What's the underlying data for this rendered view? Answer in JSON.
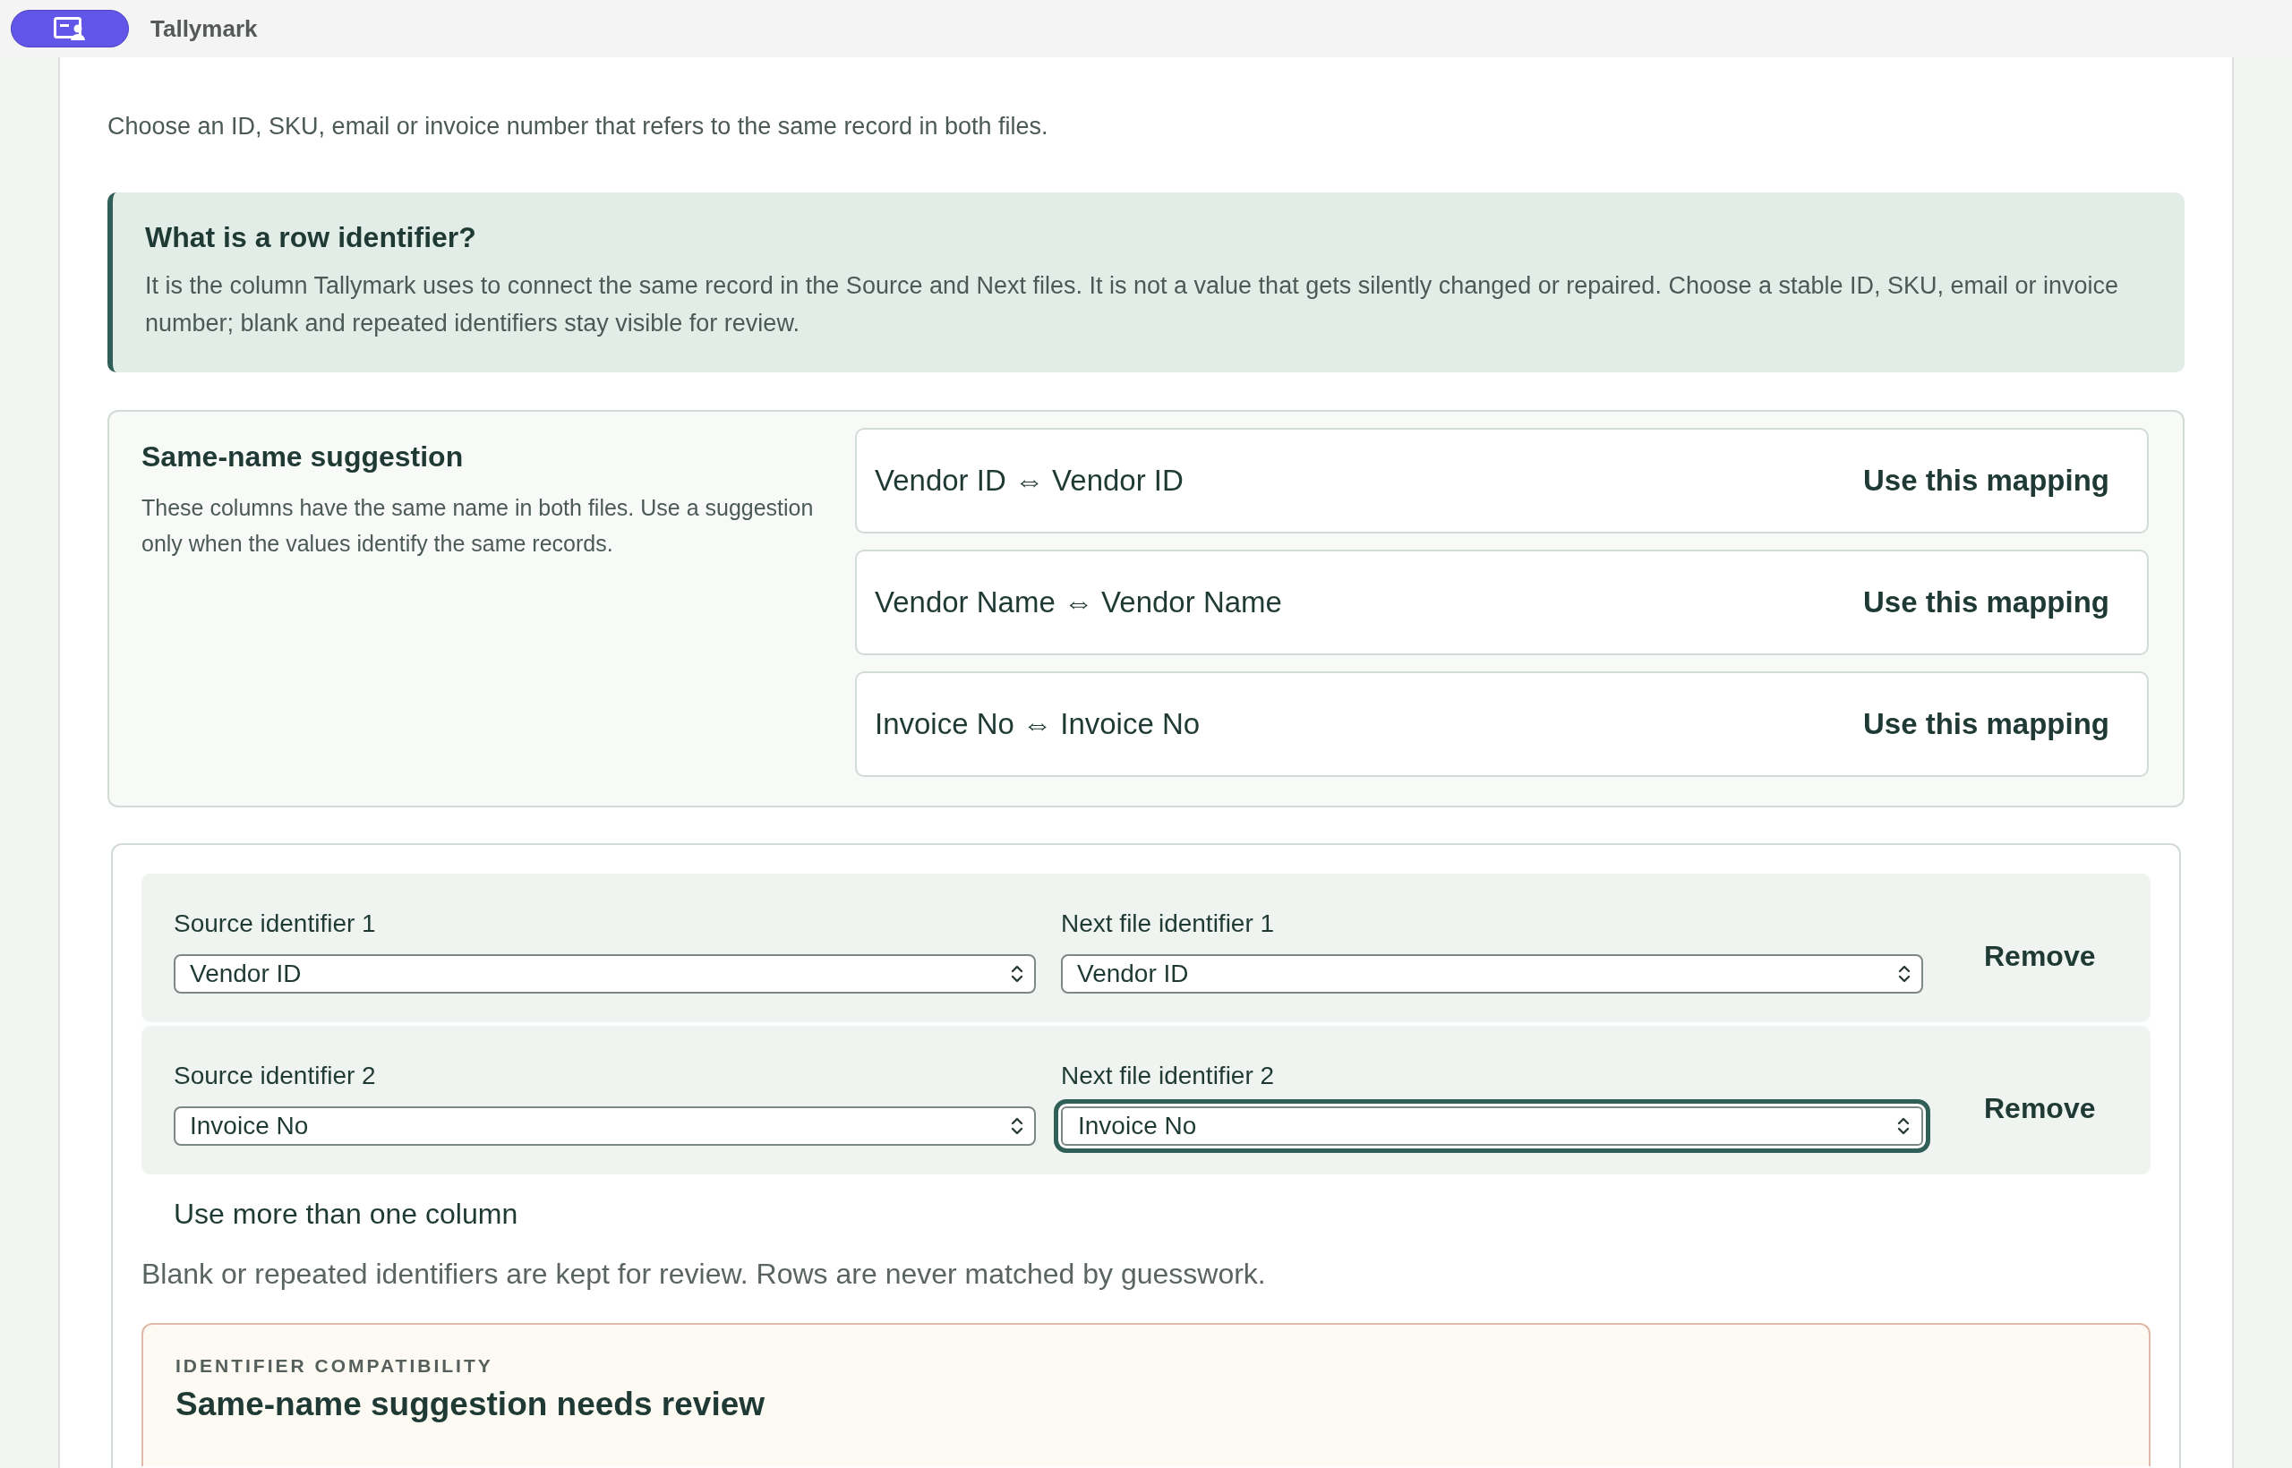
{
  "window": {
    "title": "Tallymark"
  },
  "subtitle": "Choose an ID, SKU, email or invoice number that refers to the same record in both files.",
  "info": {
    "title": "What is a row identifier?",
    "body": "It is the column Tallymark uses to connect the same record in the Source and Next files. It is not a value that gets silently changed or repaired. Choose a stable ID, SKU, email or invoice number; blank and repeated identifiers stay visible for review."
  },
  "suggestions": {
    "title": "Same-name suggestion",
    "description": "These columns have the same name in both files. Use a suggestion only when the values identify the same records.",
    "mappings": [
      {
        "pair": "Vendor ID ⇔ Vendor ID",
        "action": "Use this mapping"
      },
      {
        "pair": "Vendor Name ⇔ Vendor Name",
        "action": "Use this mapping"
      },
      {
        "pair": "Invoice No ⇔ Invoice No",
        "action": "Use this mapping"
      }
    ]
  },
  "identifiers": [
    {
      "source_label": "Source identifier 1",
      "source_value": "Vendor ID",
      "next_label": "Next file identifier 1",
      "next_value": "Vendor ID",
      "next_focused": false,
      "action": "Remove"
    },
    {
      "source_label": "Source identifier 2",
      "source_value": "Invoice No",
      "next_label": "Next file identifier 2",
      "next_value": "Invoice No",
      "next_focused": true,
      "action": "Remove"
    }
  ],
  "add_link": "Use more than one column",
  "note": "Blank or repeated identifiers are kept for review. Rows are never matched by guesswork.",
  "compatibility": {
    "eyebrow": "IDENTIFIER COMPATIBILITY",
    "title": "Same-name suggestion needs review"
  }
}
